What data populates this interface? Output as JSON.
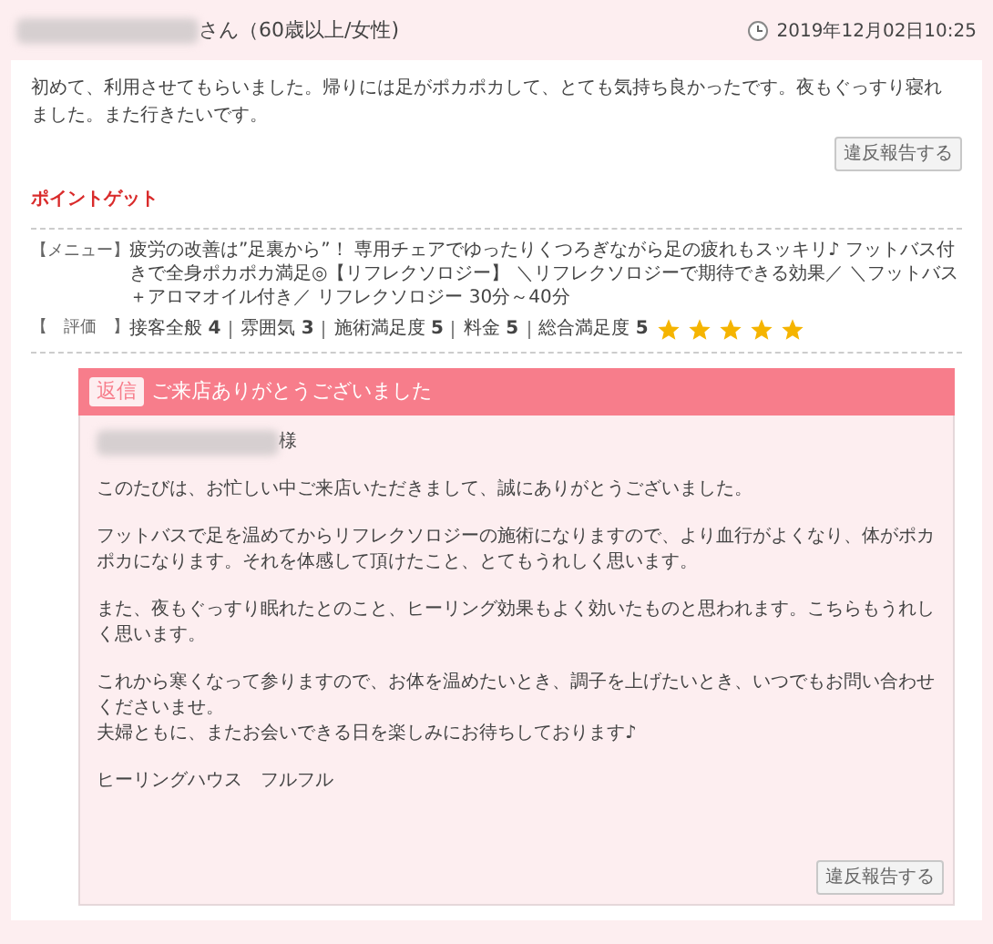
{
  "reviewer": {
    "suffix": "さん（60歳以上/女性)"
  },
  "posted": "2019年12月02日10:25",
  "review": {
    "text": "初めて、利用させてもらいました。帰りには足がポカポカして、とても気持ち良かったです。夜もぐっすり寝れました。また行きたいです。",
    "report_button": "違反報告する"
  },
  "point_get": "ポイントゲット",
  "menu": {
    "label": "【メニュー】",
    "text": "疲労の改善は”足裏から”！ 専用チェアでゆったりくつろぎながら足の疲れもスッキリ♪ フットバス付きで全身ポカポカ満足◎【リフレクソロジー】 ＼リフレクソロジーで期待できる効果／ ＼フットバス＋アロマオイル付き／ リフレクソロジー 30分～40分"
  },
  "rating": {
    "label": "【　評価　】",
    "items": [
      {
        "name": "接客全般",
        "score": "4"
      },
      {
        "name": "雰囲気",
        "score": "3"
      },
      {
        "name": "施術満足度",
        "score": "5"
      },
      {
        "name": "料金",
        "score": "5"
      },
      {
        "name": "総合満足度",
        "score": "5"
      }
    ],
    "stars": 5
  },
  "reply": {
    "badge": "返信",
    "title": "ご来店ありがとうございました",
    "salutation": "様",
    "paragraphs": [
      [
        "このたびは、お忙しい中ご来店いただきまして、誠にありがとうございました。"
      ],
      [
        "フットバスで足を温めてからリフレクソロジーの施術になりますので、より血行がよくなり、体がポカポカになります。それを体感して頂けたこと、とてもうれしく思います。"
      ],
      [
        "また、夜もぐっすり眠れたとのこと、ヒーリング効果もよく効いたものと思われます。こちらもうれしく思います。"
      ],
      [
        "これから寒くなって参りますので、お体を温めたいとき、調子を上げたいとき、いつでもお問い合わせくださいませ。",
        "夫婦ともに、またお会いできる日を楽しみにお待ちしております♪"
      ],
      [
        "ヒーリングハウス　フルフル"
      ]
    ],
    "report_button": "違反報告する"
  }
}
